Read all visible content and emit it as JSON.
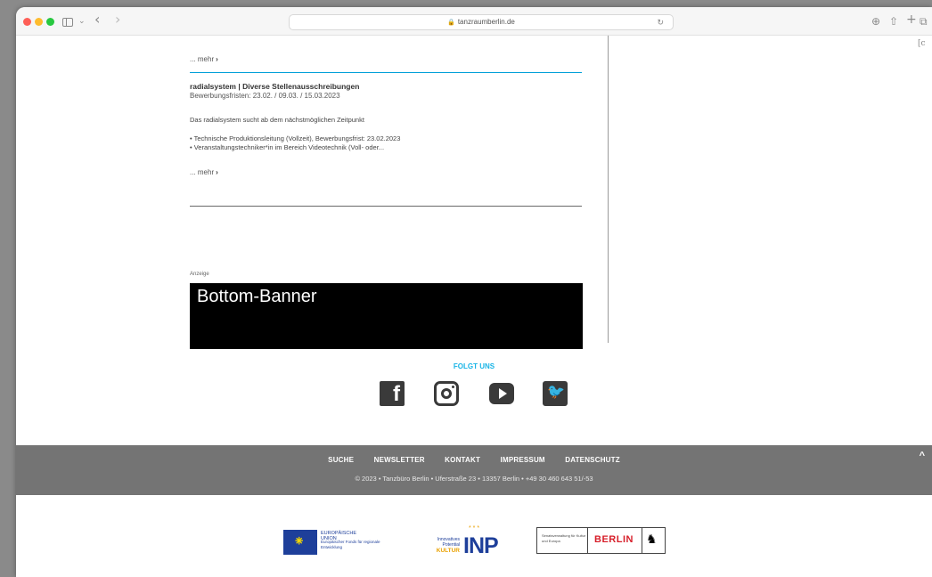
{
  "browser": {
    "url": "tanzraumberlin.de",
    "nav_back": "‹",
    "nav_forward": "›",
    "sidebar_chevron": "⌄",
    "reload": "↻",
    "download": "⊕",
    "share": "⇧",
    "new_tab": "+",
    "tabs_overview": "⧉"
  },
  "page": {
    "corner_text": "[c",
    "mehr_top": "... mehr",
    "mehr_arrow": "›",
    "article": {
      "title": "radialsystem | Diverse Stellenausschreibungen",
      "deadlines": "Bewerbungsfristen: 23.02. / 09.03. / 15.03.2023",
      "intro": "Das radialsystem sucht ab dem nächstmöglichen Zeitpunkt",
      "items": [
        "Technische Produktionsleitung (Vollzeit), Bewerbungsfrist: 23.02.2023",
        "Veranstaltungstechniker*in im Bereich Videotechnik (Voll- oder..."
      ],
      "mehr": "... mehr"
    },
    "ad_label": "Anzeige",
    "banner_text": "Bottom-Banner",
    "follow_label": "FOLGT UNS",
    "social": {
      "facebook": "f",
      "twitter": "🐦"
    }
  },
  "footer": {
    "nav": [
      "SUCHE",
      "NEWSLETTER",
      "KONTAKT",
      "IMPRESSUM",
      "DATENSCHUTZ"
    ],
    "address": "© 2023 • Tanzbüro Berlin • Uferstraße 23 • 13357 Berlin • +49 30 460 643 51/-53",
    "to_top": "^"
  },
  "logos": {
    "eu_title": "EUROPÄISCHE UNION",
    "eu_sub": "Europäischer Fonds für regionale Entwicklung",
    "inp_small": "Innovatives Potential",
    "inp_kultur": "KULTUR",
    "inp_big": "INP",
    "inp_stars": "* * *",
    "senat": "Senatsverwaltung für Kultur und Europa",
    "berlin": "BERLIN",
    "bear": "♞"
  }
}
